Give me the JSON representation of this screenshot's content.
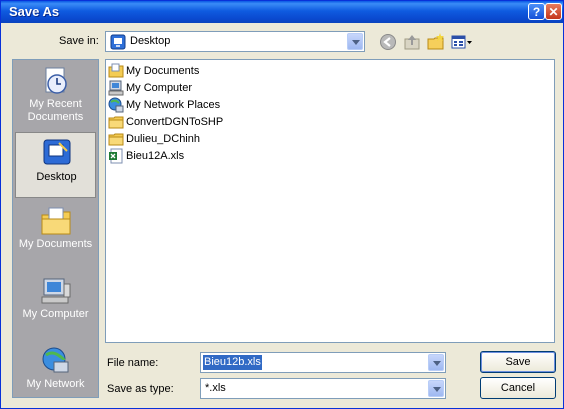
{
  "window": {
    "title": "Save As"
  },
  "toolbar": {
    "save_in_label": "Save in:",
    "save_in_value": "Desktop"
  },
  "places": [
    {
      "label": "My Recent Documents",
      "icon": "recent-documents-icon"
    },
    {
      "label": "Desktop",
      "icon": "desktop-icon"
    },
    {
      "label": "My Documents",
      "icon": "my-documents-icon"
    },
    {
      "label": "My Computer",
      "icon": "my-computer-icon"
    },
    {
      "label": "My Network",
      "icon": "my-network-icon"
    }
  ],
  "files": [
    {
      "name": "My Documents",
      "icon": "my-documents-folder-icon"
    },
    {
      "name": "My Computer",
      "icon": "my-computer-icon"
    },
    {
      "name": "My Network Places",
      "icon": "network-places-icon"
    },
    {
      "name": "ConvertDGNToSHP",
      "icon": "folder-icon"
    },
    {
      "name": "Dulieu_DChinh",
      "icon": "folder-icon"
    },
    {
      "name": "Bieu12A.xls",
      "icon": "excel-file-icon"
    }
  ],
  "form": {
    "file_name_label": "File name:",
    "file_name_value": "Bieu12b.xls",
    "save_as_type_label": "Save as type:",
    "save_as_type_value": "*.xls"
  },
  "buttons": {
    "save": "Save",
    "cancel": "Cancel"
  },
  "colors": {
    "titlebar": "#0a58e4",
    "dialog_bg": "#ece9d8",
    "places_bg": "#a7a6aa",
    "selection": "#316ac5"
  }
}
